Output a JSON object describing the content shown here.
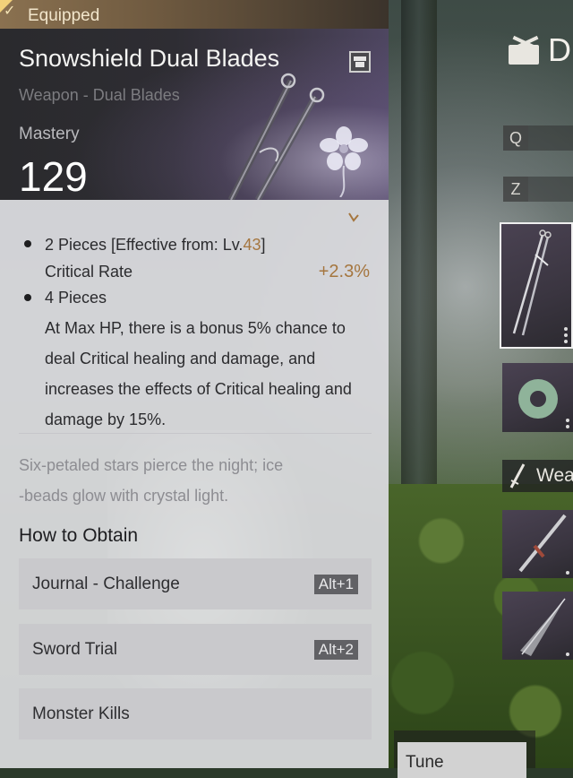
{
  "tooltip": {
    "equipped_label": "Equipped",
    "item_name": "Snowshield Dual Blades",
    "item_type": "Weapon - Dual Blades",
    "mastery_label": "Mastery",
    "mastery_value": "129",
    "set_bonus": {
      "two_piece_prefix": "2 Pieces [Effective from: Lv.",
      "two_piece_level": "43",
      "two_piece_suffix": "]",
      "stat_name": "Critical Rate",
      "stat_value": "+2.3%",
      "four_piece_label": "4 Pieces",
      "four_piece_desc": "At Max HP, there is a bonus 5% chance to deal Critical healing and damage, and increases the effects of Critical healing and damage by 15%."
    },
    "flavor_text_1": "Six-petaled stars pierce the night; ice",
    "flavor_text_2": "-beads glow with crystal light.",
    "how_to_obtain_title": "How to Obtain",
    "obtain_sources": [
      {
        "label": "Journal - Challenge",
        "hotkey": "Alt+1"
      },
      {
        "label": "Sword Trial",
        "hotkey": "Alt+2"
      },
      {
        "label": "Monster Kills",
        "hotkey": ""
      }
    ]
  },
  "side_panel": {
    "title_letter": "D",
    "key_q": "Q",
    "key_z": "Z",
    "section_label": "Wea",
    "tune_label": "Tune"
  },
  "icons": [
    "equipped-check-icon",
    "chest-icon",
    "dual-blades-icon",
    "jade-ring-icon",
    "sword-icon",
    "crossed-swords-emblem-icon",
    "more-options-icon"
  ],
  "colors": {
    "accent_gold": "#a5763f",
    "equipped_bar": "#8a7150",
    "card_background": "#dcdce0",
    "hotkey_badge": "#616165"
  }
}
